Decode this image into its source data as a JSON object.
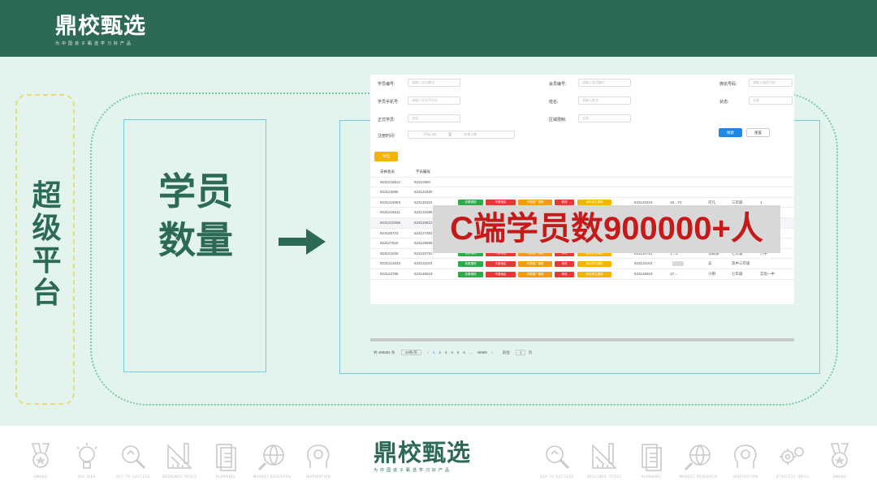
{
  "header": {
    "logo_name": "鼎校甄选",
    "logo_tagline": "为中国孩子甄选学习好产品"
  },
  "left_panel": {
    "title": "超级平台"
  },
  "middle_panel": {
    "title_line1": "学员",
    "title_line2": "数量"
  },
  "banner": {
    "text": "C端学员数900000+人"
  },
  "screenshot": {
    "filters": {
      "student_no_label": "学员编号:",
      "student_no_placeholder": "请输入学员编号",
      "member_no_label": "会员编号:",
      "member_no_placeholder": "请输入会员编号",
      "wechat_label": "微信号码:",
      "wechat_placeholder": "请输入微信号码",
      "phone_label": "学员手机号:",
      "phone_placeholder": "请输入学员手机号",
      "name_label": "姓名:",
      "name_placeholder": "请输入姓名",
      "status_label": "状态:",
      "status_value": "全部",
      "formal_label": "正式学员:",
      "formal_value": "全部",
      "region_label": "区域限制:",
      "region_value": "全部",
      "register_label": "注册时间:",
      "date_start": "开始日期",
      "date_sep": "至",
      "date_end": "结束日期",
      "search_btn": "搜索",
      "reset_btn": "重置"
    },
    "export_btn": "导出",
    "columns": [
      "去掉会员",
      "学员编号"
    ],
    "actions": [
      "查看课程",
      "不限地区",
      "不限推广课程",
      "修改",
      "添加学生课程"
    ],
    "rows": [
      {
        "member": "923121691​2",
        "sid": "6231268​4",
        "show_actions": false,
        "sid2": "",
        "name": "",
        "grade": "",
        "school": ""
      },
      {
        "member": "9231230​66",
        "sid": "6231219​30",
        "show_actions": false,
        "sid2": "",
        "name": "",
        "grade": "",
        "school": ""
      },
      {
        "member": "923121​6053",
        "sid": "623120315",
        "show_actions": true,
        "sid2": "623120315",
        "phone": "18…74",
        "name": "司凡",
        "grade": "三年级",
        "school": "1"
      },
      {
        "member": "923121​6611",
        "sid": "623121689",
        "show_actions": true,
        "sid2": "623121689",
        "phone": "",
        "name": "刘丹",
        "grade": "四年级",
        "school": "南王小学"
      },
      {
        "member": "923121​0288",
        "sid": "623120612",
        "show_actions": true,
        "sid2": "623120612",
        "phone": "18…88",
        "name": "李杰",
        "grade": "高中三年级",
        "school": ""
      },
      {
        "member": "923126723",
        "sid": "623127381",
        "show_actions": true,
        "sid2": "623127381",
        "phone": "13…9",
        "name": "王嘉昀",
        "grade": "九年级",
        "school": "自动创建"
      },
      {
        "member": "923127516",
        "sid": "623125586",
        "show_actions": true,
        "sid2": "623125586",
        "phone": "1…4",
        "name": "王琳琳",
        "grade": "五年级",
        "school": "自动创建"
      },
      {
        "member": "923121​636",
        "sid": "623120751",
        "show_actions": true,
        "sid2": "623120751",
        "phone": "1…3",
        "name": "马婉泽",
        "grade": "七年级",
        "school": "六中"
      },
      {
        "member": "923121​2533",
        "sid": "623121153",
        "show_actions": true,
        "sid2": "623121153",
        "phone": "",
        "name": "吴",
        "grade": "高中三年级",
        "school": ""
      },
      {
        "member": "923123786",
        "sid": "623126619",
        "show_actions": true,
        "sid2": "623126619",
        "phone": "17…",
        "name": "小明",
        "grade": "七年级",
        "school": "实验一中"
      }
    ],
    "pager": {
      "total": "共 499891 条",
      "per_page": "10条/页",
      "pages": [
        "‹",
        "1",
        "2",
        "3",
        "4",
        "5",
        "6",
        "…",
        "49989",
        "›"
      ],
      "goto_label": "前往",
      "goto_value": "1",
      "goto_suffix": "页"
    }
  },
  "footer": {
    "logo_name": "鼎校甄选",
    "logo_tagline": "为中国孩子甄选学习好产品",
    "left_icons": [
      {
        "icon": "medal-icon",
        "caption": "AWARD"
      },
      {
        "icon": "lightbulb-icon",
        "caption": "BIG IDEA"
      },
      {
        "icon": "magnifier-icon",
        "caption": "KEY TO SUCCESS"
      },
      {
        "icon": "ruler-icon",
        "caption": "DESIGNER TOOLS"
      },
      {
        "icon": "document-icon",
        "caption": "PLANNING"
      },
      {
        "icon": "globe-search-icon",
        "caption": "MARKET RESEARCH"
      },
      {
        "icon": "head-bulb-icon",
        "caption": "INSPIRATION"
      }
    ],
    "right_icons": [
      {
        "icon": "magnifier-icon",
        "caption": "KEY TO SUCCESS"
      },
      {
        "icon": "ruler-icon",
        "caption": "DESIGNER TOOLS"
      },
      {
        "icon": "document-icon",
        "caption": "PLANNING"
      },
      {
        "icon": "globe-search-icon",
        "caption": "MARKET RESEARCH"
      },
      {
        "icon": "head-bulb-icon",
        "caption": "INSPIRATION"
      },
      {
        "icon": "gears-icon",
        "caption": "STRATEGY IDEAS"
      },
      {
        "icon": "medal-icon",
        "caption": "AWARD"
      }
    ]
  },
  "colors": {
    "brand_green": "#2d6a55",
    "banner_red": "#c61a1a",
    "background_mint": "#e3f4ee"
  }
}
